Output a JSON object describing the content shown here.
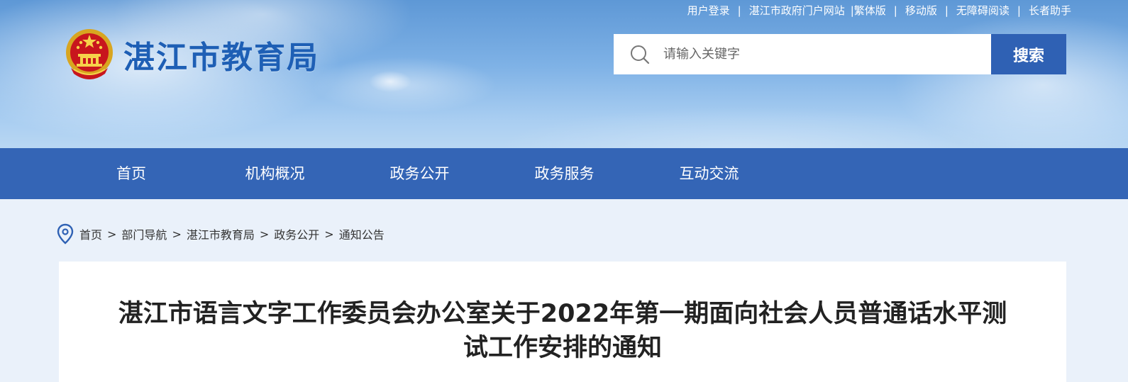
{
  "top_links": [
    {
      "label": "用户登录"
    },
    {
      "label": "湛江市政府门户网站"
    },
    {
      "label": "|繁体版"
    },
    {
      "label": "移动版"
    },
    {
      "label": "无障碍阅读"
    },
    {
      "label": "长者助手"
    }
  ],
  "site": {
    "title": "湛江市教育局",
    "emblem_icon": "national-emblem-icon"
  },
  "search": {
    "placeholder": "请输入关键字",
    "button_label": "搜索",
    "icon": "search-icon"
  },
  "nav": {
    "items": [
      {
        "label": "首页"
      },
      {
        "label": "机构概况"
      },
      {
        "label": "政务公开"
      },
      {
        "label": "政务服务"
      },
      {
        "label": "互动交流"
      }
    ]
  },
  "breadcrumb": {
    "icon": "location-pin-icon",
    "items": [
      {
        "label": "首页"
      },
      {
        "label": "部门导航"
      },
      {
        "label": "湛江市教育局"
      },
      {
        "label": "政务公开"
      },
      {
        "label": "通知公告"
      }
    ],
    "separator": ">"
  },
  "article": {
    "title": "湛江市语言文字工作委员会办公室关于2022年第一期面向社会人员普通话水平测试工作安排的通知"
  },
  "colors": {
    "nav_bg": "#3465b6",
    "search_button": "#2f61b4",
    "title_blue": "#1e5fb5",
    "page_bg": "#eaf1fa"
  }
}
